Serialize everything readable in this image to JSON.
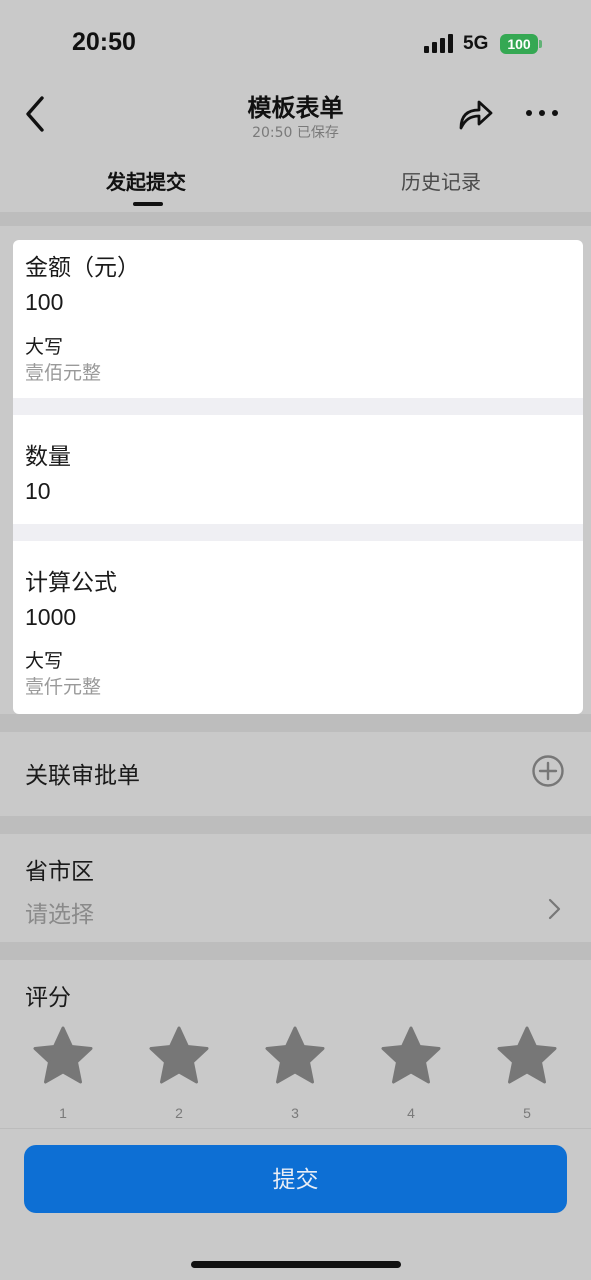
{
  "status_bar": {
    "time": "20:50",
    "network": "5G",
    "battery": "100"
  },
  "nav": {
    "title": "模板表单",
    "subtitle": "20:50 已保存"
  },
  "tabs": [
    {
      "label": "发起提交",
      "active": true
    },
    {
      "label": "历史记录",
      "active": false
    }
  ],
  "fields": {
    "amount": {
      "label": "金额（元）",
      "value": "100",
      "caps_label": "大写",
      "caps_value": "壹佰元整"
    },
    "quantity": {
      "label": "数量",
      "value": "10"
    },
    "formula": {
      "label": "计算公式",
      "value": "1000",
      "caps_label": "大写",
      "caps_value": "壹仟元整"
    },
    "related": {
      "label": "关联审批单"
    },
    "region": {
      "label": "省市区",
      "placeholder": "请选择"
    },
    "rating": {
      "label": "评分",
      "stars": [
        "1",
        "2",
        "3",
        "4",
        "5"
      ],
      "value": 0
    }
  },
  "submit_label": "提交",
  "icons": {
    "back": "chevron-left-icon",
    "share": "share-arrow-icon",
    "more": "more-dots-icon",
    "add": "plus-circle-icon",
    "chevron": "chevron-right-icon",
    "star": "star-icon"
  },
  "colors": {
    "primary": "#0d6fd4",
    "battery": "#35a853",
    "star": "#777777"
  }
}
